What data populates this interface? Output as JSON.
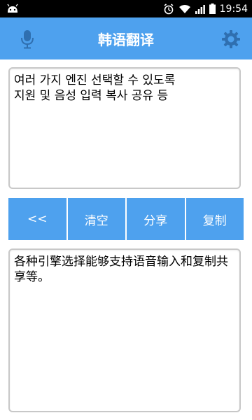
{
  "status_bar": {
    "time": "19:54"
  },
  "app_bar": {
    "title": "韩语翻译"
  },
  "source_text": "여러 가지 엔진 선택할 수 있도록\n지원 및 음성 입력 복사 공유 등",
  "buttons": {
    "back": "<<",
    "clear": "清空",
    "share": "分享",
    "copy": "复制"
  },
  "result_text": "各种引擎选择能够支持语音输入和复制共享等。",
  "colors": {
    "accent": "#4ea1ee",
    "status_bar": "#000000",
    "border": "#c8c8c8"
  },
  "icons": [
    "android-icon",
    "alarm-icon",
    "wifi-icon",
    "signal-icon",
    "battery-icon",
    "microphone-icon",
    "gear-icon"
  ]
}
